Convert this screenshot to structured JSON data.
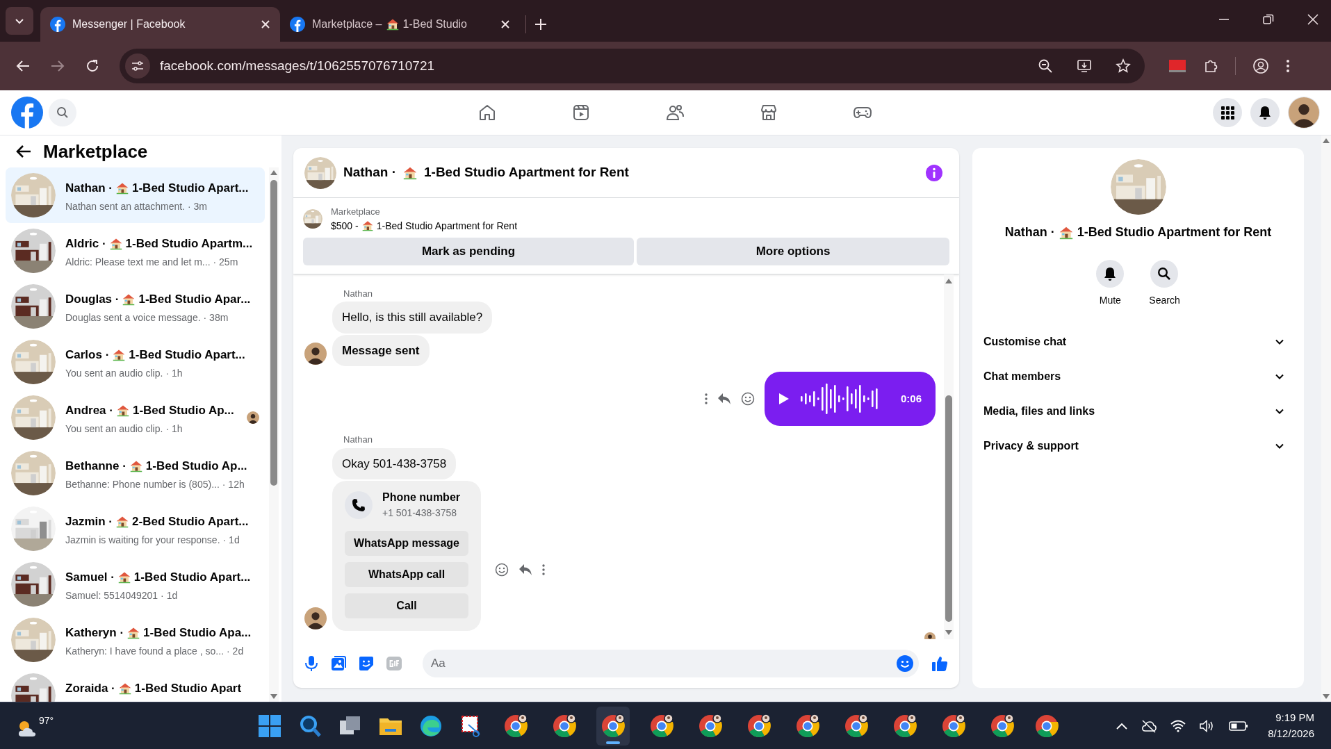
{
  "browser": {
    "tabs": [
      {
        "title": "Messenger | Facebook",
        "selected": true
      },
      {
        "title": "Marketplace –",
        "suffix": "1-Bed Studio",
        "selected": false
      }
    ],
    "url": "facebook.com/messages/t/1062557076710721"
  },
  "nav": {
    "items": [
      {
        "kind": "home"
      },
      {
        "kind": "video"
      },
      {
        "kind": "friends"
      },
      {
        "kind": "store"
      },
      {
        "kind": "gaming"
      }
    ]
  },
  "sidebar": {
    "title": "Marketplace",
    "conversations": [
      {
        "name": "Nathan ·",
        "listing": "1-Bed Studio Apart...",
        "preview": "Nathan sent an attachment.",
        "time": "· 3m",
        "selected": true,
        "seen": false
      },
      {
        "name": "Aldric ·",
        "listing": "1-Bed Studio Apartm...",
        "preview": "Aldric: Please text me and let m...",
        "time": "· 25m",
        "selected": false,
        "seen": false
      },
      {
        "name": "Douglas ·",
        "listing": "1-Bed Studio Apar...",
        "preview": "Douglas sent a voice message.",
        "time": "· 38m",
        "selected": false,
        "seen": false
      },
      {
        "name": "Carlos ·",
        "listing": "1-Bed Studio Apart...",
        "preview": "You sent an audio clip.",
        "time": "· 1h",
        "selected": false,
        "seen": false
      },
      {
        "name": "Andrea ·",
        "listing": "1-Bed Studio Ap...",
        "preview": "You sent an audio clip.",
        "time": "· 1h",
        "selected": false,
        "seen": true
      },
      {
        "name": "Bethanne ·",
        "listing": "1-Bed Studio Ap...",
        "preview": "Bethanne: Phone number is (805)...",
        "time": "· 12h",
        "selected": false,
        "seen": false
      },
      {
        "name": "Jazmin ·",
        "listing": "2-Bed Studio Apart...",
        "preview": "Jazmin is waiting for your response.",
        "time": "· 1d",
        "selected": false,
        "seen": false
      },
      {
        "name": "Samuel ·",
        "listing": "1-Bed Studio Apart...",
        "preview": "Samuel: 5514049201",
        "time": "· 1d",
        "selected": false,
        "seen": false
      },
      {
        "name": "Katheryn ·",
        "listing": "1-Bed Studio Apa...",
        "preview": "Katheryn: I have found a place , so...",
        "time": "· 2d",
        "selected": false,
        "seen": false
      },
      {
        "name": "Zoraida ·",
        "listing": "1-Bed Studio Apart",
        "selected": false,
        "seen": false
      }
    ]
  },
  "chat": {
    "name": "Nathan ·",
    "listing": "1-Bed Studio Apartment for Rent",
    "marketplace": {
      "label": "Marketplace",
      "price": "$500 -",
      "listing": "1-Bed Studio Apartment for Rent",
      "buttons": [
        "Mark as pending",
        "More options"
      ]
    },
    "messages": [
      {
        "kind": "sender",
        "text": "Nathan"
      },
      {
        "kind": "incoming",
        "text": "Hello, is this still available?",
        "bold": false,
        "avatar": false
      },
      {
        "kind": "incoming",
        "text": "Message sent",
        "bold": true,
        "avatar": true
      },
      {
        "kind": "audio",
        "duration": "0:06"
      },
      {
        "kind": "sender",
        "text": "Nathan"
      },
      {
        "kind": "incoming",
        "text": "Okay 501-438-3758",
        "bold": false,
        "avatar": false
      },
      {
        "kind": "phone_card",
        "title": "Phone number",
        "number": "+1 501-438-3758",
        "actions": [
          "WhatsApp message",
          "WhatsApp call",
          "Call"
        ],
        "avatar": true
      }
    ],
    "composer": {
      "placeholder": "Aa"
    }
  },
  "details": {
    "name": "Nathan ·",
    "listing": "1-Bed Studio Apartment for Rent",
    "actions": [
      {
        "kind": "bell",
        "label": "Mute"
      },
      {
        "kind": "search",
        "label": "Search"
      }
    ],
    "sections": [
      "Customise chat",
      "Chat members",
      "Media, files and links",
      "Privacy & support"
    ]
  },
  "taskbar": {
    "temperature": "97°",
    "time": "9:19 PM",
    "date": "8/12/2026"
  }
}
